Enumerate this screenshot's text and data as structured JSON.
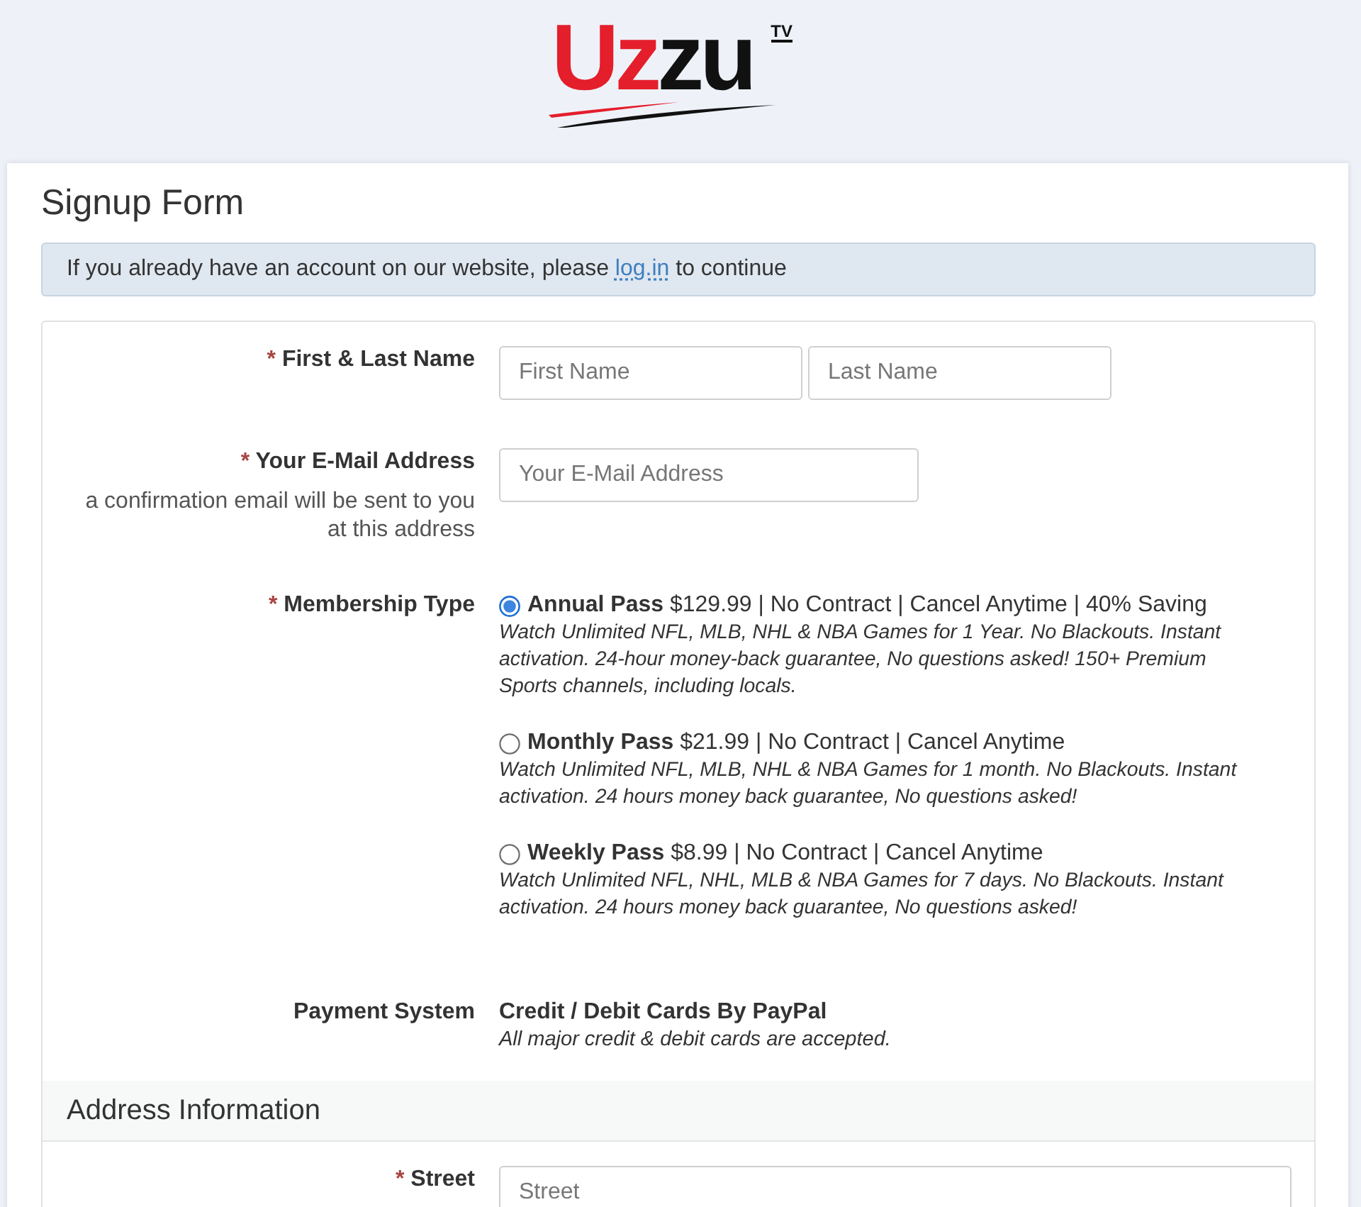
{
  "logo": {
    "wordmark": "Uzzu",
    "badge": "TV"
  },
  "page_title": "Signup Form",
  "notice": {
    "text_before": "If you already have an account on our website, please",
    "link": "log.in",
    "text_after": "to continue"
  },
  "form": {
    "rows": [
      {
        "kind": "pair",
        "label": "First & Last Name",
        "required_mark": "*",
        "inputs": [
          {
            "placeholder": "First Name"
          },
          {
            "placeholder": "Last Name"
          }
        ]
      },
      {
        "kind": "short",
        "label": "Your E-Mail Address",
        "required_mark": "*",
        "hint": "a confirmation email will be sent to you at this address",
        "inputs": [
          {
            "placeholder": "Your E-Mail Address"
          }
        ]
      },
      {
        "kind": "choice",
        "label": "Membership Type",
        "required_mark": "*",
        "options": [
          {
            "title": "**Annual Pass** $129.99 | No Contract | Cancel Anytime | 40% Saving",
            "description": "Watch Unlimited NFL, MLB, NHL & NBA Games for 1 Year. No Blackouts. Instant activation. 24-hour money-back guarantee, No questions asked! 150+ Premium Sports channels, including locals.",
            "selected": true
          },
          {
            "title": "**Monthly Pass** $21.99 | No Contract | Cancel Anytime",
            "description": "Watch Unlimited NFL, MLB, NHL & NBA Games for 1 month. No Blackouts. Instant activation. 24 hours money back guarantee, No questions asked!",
            "selected": false
          },
          {
            "title": "**Weekly Pass** $8.99 | No Contract | Cancel Anytime",
            "description": "Watch Unlimited NFL, NHL, MLB & NBA Games for 7 days. No Blackouts. Instant activation. 24 hours money back guarantee, No questions asked!",
            "selected": false
          }
        ]
      },
      {
        "kind": "static",
        "label": "Payment System",
        "value": "Credit / Debit Cards By PayPal",
        "note": "All major credit & debit cards are accepted."
      }
    ]
  },
  "address_section": {
    "title": "Address Information",
    "rows": [
      {
        "kind": "wide",
        "label": "Street",
        "required_mark": "*",
        "inputs": [
          {
            "placeholder": "Street"
          }
        ]
      }
    ]
  }
}
